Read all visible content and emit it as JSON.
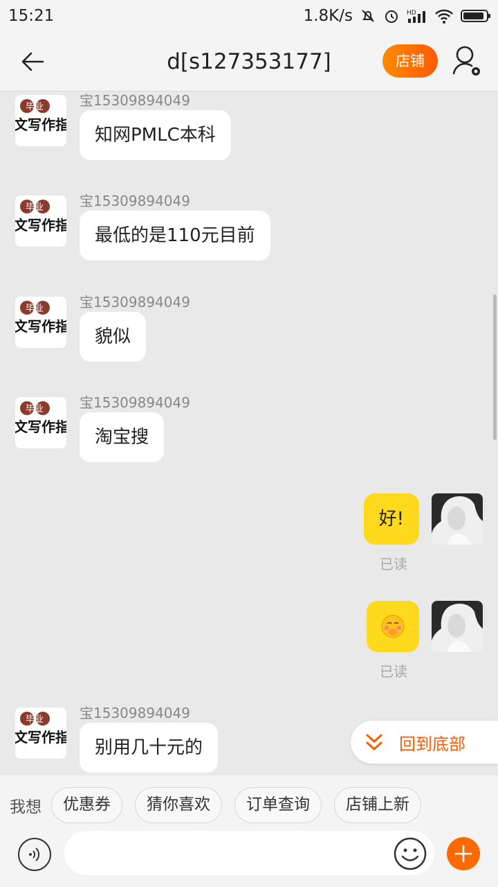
{
  "status_bar": {
    "time": "15:21",
    "net_speed": "1.8K/s",
    "icons": [
      "mute-icon",
      "alarm-icon",
      "hd-signal-icon",
      "wifi-icon",
      "battery-icon"
    ],
    "signal_label": "HD"
  },
  "header": {
    "title": "d[s127353177]",
    "shop_button": "店铺",
    "accent_color": "#ff6a00"
  },
  "shop_avatar": {
    "line1": "毕业",
    "line2": "文写作指"
  },
  "messages": [
    {
      "direction": "in",
      "sender": "宝15309894049",
      "text": "知网PMLC本科"
    },
    {
      "direction": "in",
      "sender": "宝15309894049",
      "text": "最低的是110元目前"
    },
    {
      "direction": "in",
      "sender": "宝15309894049",
      "text": "貌似"
    },
    {
      "direction": "in",
      "sender": "宝15309894049",
      "text": "淘宝搜"
    },
    {
      "direction": "out",
      "text": "好!",
      "status": "已读"
    },
    {
      "direction": "out",
      "emoji": "blushing-emoji",
      "status": "已读"
    },
    {
      "direction": "in",
      "sender": "宝15309894049",
      "text": "别用几十元的"
    }
  ],
  "back_to_bottom": "回到底部",
  "quick_bar": {
    "label": "我想",
    "chips": [
      "优惠券",
      "猜你喜欢",
      "订单查询",
      "店铺上新"
    ]
  },
  "input": {
    "placeholder": ""
  }
}
